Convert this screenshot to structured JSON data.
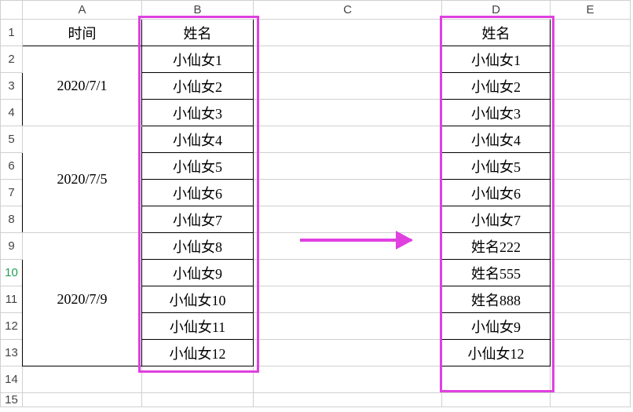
{
  "columns": [
    "A",
    "B",
    "C",
    "D",
    "E"
  ],
  "rows": [
    "1",
    "2",
    "3",
    "4",
    "5",
    "6",
    "7",
    "8",
    "9",
    "10",
    "11",
    "12",
    "13",
    "14",
    "15"
  ],
  "selectedRow": 10,
  "header": {
    "time": "时间",
    "name": "姓名",
    "nameD": "姓名"
  },
  "groups": [
    {
      "date": "2020/7/1",
      "span": 3
    },
    {
      "date": "2020/7/5",
      "span": 4
    },
    {
      "date": "2020/7/9",
      "span": 5
    }
  ],
  "colB": [
    "小仙女1",
    "小仙女2",
    "小仙女3",
    "小仙女4",
    "小仙女5",
    "小仙女6",
    "小仙女7",
    "小仙女8",
    "小仙女9",
    "小仙女10",
    "小仙女11",
    "小仙女12"
  ],
  "colD": [
    "小仙女1",
    "小仙女2",
    "小仙女3",
    "小仙女4",
    "小仙女5",
    "小仙女6",
    "小仙女7",
    "姓名222",
    "姓名555",
    "姓名888",
    "小仙女9",
    "小仙女12"
  ]
}
